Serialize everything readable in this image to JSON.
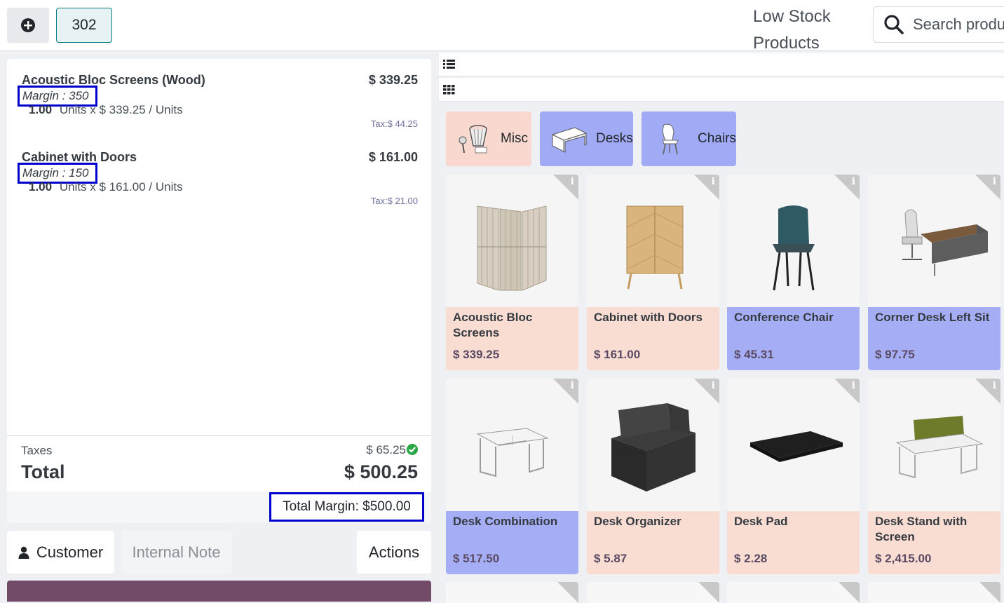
{
  "header": {
    "order_number": "302",
    "low_stock_label": "Low Stock Products",
    "search_placeholder": "Search products..."
  },
  "order_lines": [
    {
      "name": "Acoustic Bloc Screens (Wood)",
      "price": "$ 339.25",
      "margin": "Margin : 350",
      "qty": "1.00",
      "qty_detail": "Units x $ 339.25 / Units",
      "tax": "Tax:$ 44.25"
    },
    {
      "name": "Cabinet with Doors",
      "price": "$ 161.00",
      "margin": "Margin : 150",
      "qty": "1.00",
      "qty_detail": "Units x $ 161.00 / Units",
      "tax": "Tax:$ 21.00"
    }
  ],
  "totals": {
    "taxes_label": "Taxes",
    "taxes_value": "$ 65.25",
    "total_label": "Total",
    "total_value": "$ 500.25",
    "total_margin": "Total Margin: $500.00"
  },
  "actions": {
    "customer": "Customer",
    "internal_note": "Internal Note",
    "actions": "Actions"
  },
  "categories": [
    {
      "label": "Misc",
      "color": "#f9d9cf"
    },
    {
      "label": "Desks",
      "color": "#a0aaf5"
    },
    {
      "label": "Chairs",
      "color": "#a0aaf5"
    }
  ],
  "products": [
    {
      "name": "Acoustic Bloc Screens",
      "price": "$ 339.25",
      "color": "#f9ddd2",
      "icon": "screen-divider-image"
    },
    {
      "name": "Cabinet with Doors",
      "price": "$ 161.00",
      "color": "#f9ddd2",
      "icon": "cabinet-image"
    },
    {
      "name": "Conference Chair",
      "price": "$ 45.31",
      "color": "#a5aef5",
      "icon": "chair-image"
    },
    {
      "name": "Corner Desk Left Sit",
      "price": "$ 97.75",
      "color": "#a5aef5",
      "icon": "office-desk-image"
    },
    {
      "name": "Desk Combination",
      "price": "$ 517.50",
      "color": "#a5aef5",
      "icon": "desk-combination-image"
    },
    {
      "name": "Desk Organizer",
      "price": "$ 5.87",
      "color": "#f9ddd2",
      "icon": "desk-organizer-image"
    },
    {
      "name": "Desk Pad",
      "price": "$ 2.28",
      "color": "#f9ddd2",
      "icon": "desk-pad-image"
    },
    {
      "name": "Desk Stand with Screen",
      "price": "$ 2,415.00",
      "color": "#f9ddd2",
      "icon": "desk-stand-image"
    }
  ],
  "colors": {
    "accent_teal": "#017e84",
    "highlight_box": "#0000cc",
    "pay_bar": "#714b67",
    "check_green": "#28a745"
  },
  "product_info_glyph": "i"
}
